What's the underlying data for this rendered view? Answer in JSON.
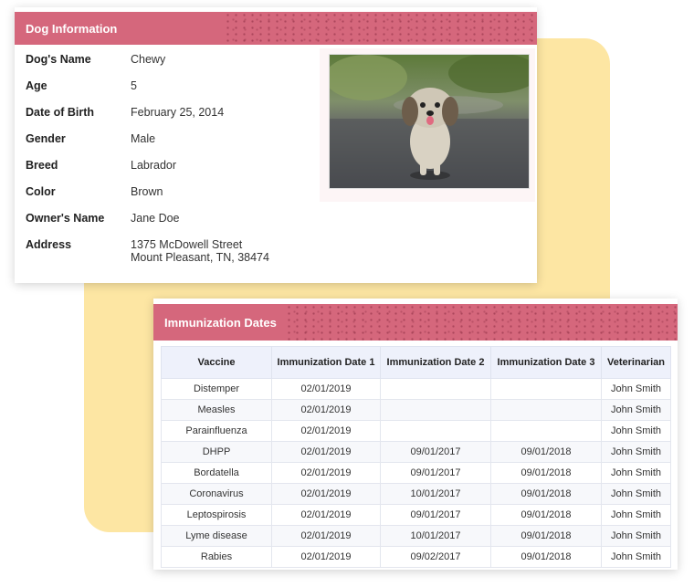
{
  "dog_info": {
    "title": "Dog Information",
    "fields": [
      {
        "label": "Dog's Name",
        "value": "Chewy"
      },
      {
        "label": "Age",
        "value": "5"
      },
      {
        "label": "Date of Birth",
        "value": "February 25, 2014"
      },
      {
        "label": "Gender",
        "value": "Male"
      },
      {
        "label": "Breed",
        "value": "Labrador"
      },
      {
        "label": "Color",
        "value": "Brown"
      },
      {
        "label": "Owner's Name",
        "value": "Jane Doe"
      }
    ],
    "address_label": "Address",
    "address_line1": "1375 McDowell Street",
    "address_line2": "Mount Pleasant, TN, 38474"
  },
  "immunization": {
    "title": "Immunization Dates",
    "headers": [
      "Vaccine",
      "Immunization Date 1",
      "Immunization Date 2",
      "Immunization Date 3",
      "Veterinarian"
    ],
    "rows": [
      [
        "Distemper",
        "02/01/2019",
        "",
        "",
        "John Smith"
      ],
      [
        "Measles",
        "02/01/2019",
        "",
        "",
        "John Smith"
      ],
      [
        "Parainfluenza",
        "02/01/2019",
        "",
        "",
        "John Smith"
      ],
      [
        "DHPP",
        "02/01/2019",
        "09/01/2017",
        "09/01/2018",
        "John Smith"
      ],
      [
        "Bordatella",
        "02/01/2019",
        "09/01/2017",
        "09/01/2018",
        "John Smith"
      ],
      [
        "Coronavirus",
        "02/01/2019",
        "10/01/2017",
        "09/01/2018",
        "John Smith"
      ],
      [
        "Leptospirosis",
        "02/01/2019",
        "09/01/2017",
        "09/01/2018",
        "John Smith"
      ],
      [
        "Lyme disease",
        "02/01/2019",
        "10/01/2017",
        "09/01/2018",
        "John Smith"
      ],
      [
        "Rabies",
        "02/01/2019",
        "09/02/2017",
        "09/01/2018",
        "John Smith"
      ]
    ]
  },
  "colors": {
    "header": "#d5677c",
    "accent_bg": "#fde6a3",
    "table_header": "#eef1fb"
  }
}
